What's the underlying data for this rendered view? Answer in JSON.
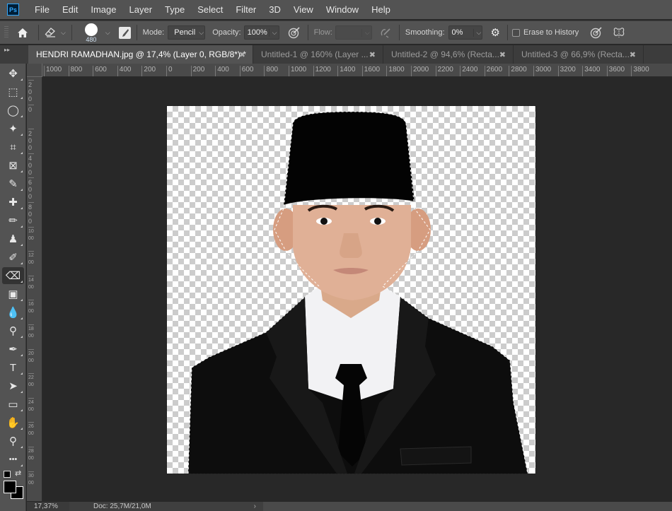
{
  "app": {
    "logo": "Ps",
    "menu": [
      "File",
      "Edit",
      "Image",
      "Layer",
      "Type",
      "Select",
      "Filter",
      "3D",
      "View",
      "Window",
      "Help"
    ]
  },
  "options_bar": {
    "brush_size": "480",
    "mode_label": "Mode:",
    "mode_value": "Pencil",
    "opacity_label": "Opacity:",
    "opacity_value": "100%",
    "flow_label": "Flow:",
    "flow_value": "",
    "smoothing_label": "Smoothing:",
    "smoothing_value": "0%",
    "erase_to_history_label": "Erase to History",
    "erase_to_history_checked": false
  },
  "tabs": [
    {
      "label": "HENDRI RAMADHAN.jpg @ 17,4% (Layer 0, RGB/8*) *",
      "active": true
    },
    {
      "label": "Untitled-1 @ 160% (Layer ...",
      "active": false
    },
    {
      "label": "Untitled-2 @ 94,6% (Recta...",
      "active": false
    },
    {
      "label": "Untitled-3 @ 66,9% (Recta...",
      "active": false
    }
  ],
  "tab_close_glyph": "✖",
  "ruler_h": [
    "1000",
    "800",
    "600",
    "400",
    "200",
    "0",
    "200",
    "400",
    "600",
    "800",
    "1000",
    "1200",
    "1400",
    "1600",
    "1800",
    "2000",
    "2200",
    "2400",
    "2600",
    "2800",
    "3000",
    "3200",
    "3400",
    "3600",
    "3800"
  ],
  "ruler_v": [
    "200",
    "0",
    "200",
    "400",
    "600",
    "800",
    "1000",
    "1200",
    "1400",
    "1600",
    "1800",
    "2000",
    "2200",
    "2400",
    "2600",
    "2800",
    "3000"
  ],
  "tools": [
    {
      "name": "move-tool",
      "glyph": "✥"
    },
    {
      "name": "marquee-tool",
      "glyph": "⬚"
    },
    {
      "name": "lasso-tool",
      "glyph": "◯"
    },
    {
      "name": "magic-wand-tool",
      "glyph": "✦"
    },
    {
      "name": "crop-tool",
      "glyph": "⌗"
    },
    {
      "name": "frame-tool",
      "glyph": "⊠"
    },
    {
      "name": "eyedropper-tool",
      "glyph": "✎"
    },
    {
      "name": "healing-brush-tool",
      "glyph": "✚"
    },
    {
      "name": "brush-tool",
      "glyph": "✏"
    },
    {
      "name": "clone-stamp-tool",
      "glyph": "♟"
    },
    {
      "name": "history-brush-tool",
      "glyph": "✐"
    },
    {
      "name": "eraser-tool",
      "glyph": "⌫",
      "active": true
    },
    {
      "name": "gradient-tool",
      "glyph": "▣"
    },
    {
      "name": "blur-tool",
      "glyph": "💧"
    },
    {
      "name": "dodge-tool",
      "glyph": "⚲"
    },
    {
      "name": "pen-tool",
      "glyph": "✒"
    },
    {
      "name": "type-tool",
      "glyph": "T"
    },
    {
      "name": "path-selection-tool",
      "glyph": "➤"
    },
    {
      "name": "rectangle-tool",
      "glyph": "▭"
    },
    {
      "name": "hand-tool",
      "glyph": "✋"
    },
    {
      "name": "zoom-tool",
      "glyph": "⚲"
    },
    {
      "name": "edit-toolbar",
      "glyph": "•••"
    }
  ],
  "colors": {
    "foreground": "#000000",
    "background": "#000000",
    "accent": "#31a8ff"
  },
  "status": {
    "zoom": "17,37%",
    "doc": "Doc: 25,7M/21,0M",
    "arrow": "›"
  }
}
